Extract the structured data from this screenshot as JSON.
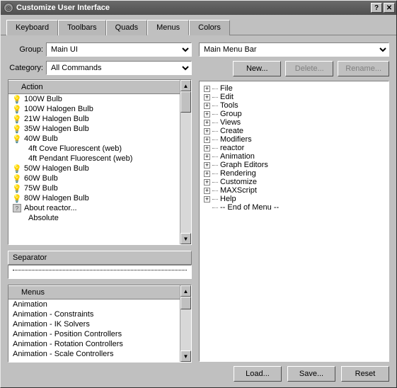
{
  "title": "Customize User Interface",
  "tabs": [
    "Keyboard",
    "Toolbars",
    "Quads",
    "Menus",
    "Colors"
  ],
  "active_tab": 3,
  "labels": {
    "group": "Group:",
    "category": "Category:",
    "action_header": "Action",
    "separator": "Separator",
    "menus_header": "Menus"
  },
  "group_value": "Main UI",
  "category_value": "All Commands",
  "actions": [
    {
      "icon": "bulb",
      "label": "100W Bulb"
    },
    {
      "icon": "bulb",
      "label": "100W Halogen Bulb"
    },
    {
      "icon": "bulb",
      "label": "21W Halogen Bulb"
    },
    {
      "icon": "bulb",
      "label": "35W Halogen Bulb"
    },
    {
      "icon": "bulb",
      "label": "40W Bulb"
    },
    {
      "icon": "none",
      "label": "4ft Cove Fluorescent (web)",
      "indent": true
    },
    {
      "icon": "none",
      "label": "4ft Pendant Fluorescent (web)",
      "indent": true
    },
    {
      "icon": "bulb",
      "label": "50W Halogen Bulb"
    },
    {
      "icon": "bulb",
      "label": "60W Bulb"
    },
    {
      "icon": "bulb",
      "label": "75W Bulb"
    },
    {
      "icon": "bulb",
      "label": "80W Halogen Bulb"
    },
    {
      "icon": "q",
      "label": "About reactor..."
    },
    {
      "icon": "none",
      "label": "Absolute",
      "indent": true
    }
  ],
  "menus_list": [
    "Animation",
    "Animation - Constraints",
    "Animation - IK Solvers",
    "Animation - Position Controllers",
    "Animation - Rotation Controllers",
    "Animation - Scale Controllers"
  ],
  "right_combo": "Main Menu Bar",
  "right_buttons": {
    "new": "New...",
    "delete": "Delete...",
    "rename": "Rename..."
  },
  "tree": [
    "File",
    "Edit",
    "Tools",
    "Group",
    "Views",
    "Create",
    "Modifiers",
    "reactor",
    "Animation",
    "Graph Editors",
    "Rendering",
    "Customize",
    "MAXScript",
    "Help"
  ],
  "tree_end": "-- End of Menu --",
  "bottom_buttons": {
    "load": "Load...",
    "save": "Save...",
    "reset": "Reset"
  }
}
